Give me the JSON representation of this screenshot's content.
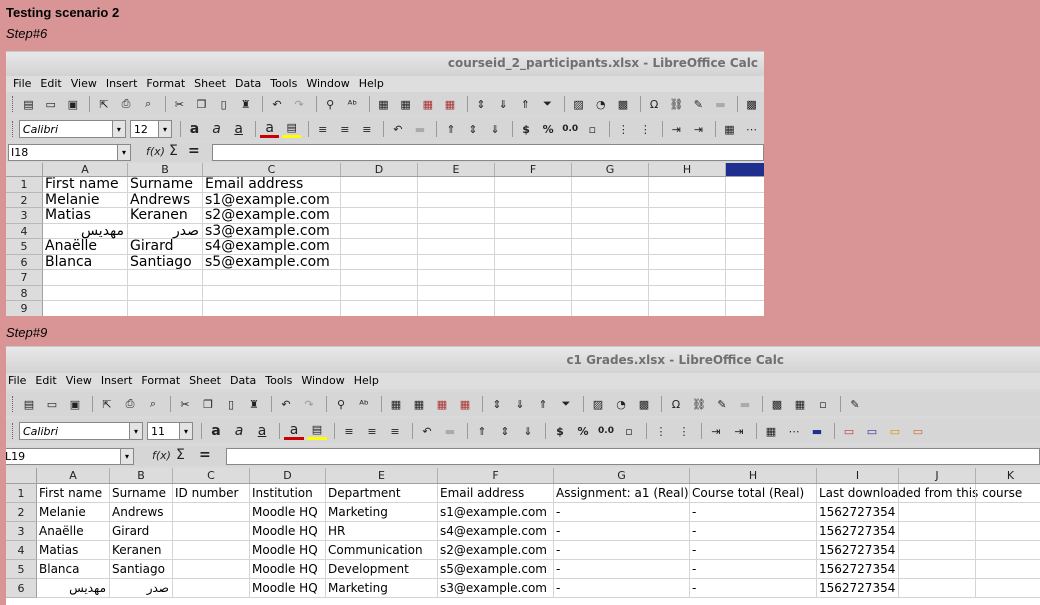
{
  "scenario_title": "Testing scenario 2",
  "steps": [
    "Step#6",
    "Step#9"
  ],
  "menu": [
    "File",
    "Edit",
    "View",
    "Insert",
    "Format",
    "Sheet",
    "Data",
    "Tools",
    "Window",
    "Help"
  ],
  "window1": {
    "title": "courseid_2_participants.xlsx - LibreOffice Calc",
    "font_name": "Calibri",
    "font_size": "12",
    "cell_ref": "I18",
    "fx_label": "f(x)",
    "sigma": "Σ",
    "equals": "=",
    "columns": [
      "A",
      "B",
      "C",
      "D",
      "E",
      "F",
      "G",
      "H"
    ],
    "rows": [
      "1",
      "2",
      "3",
      "4",
      "5",
      "6",
      "7",
      "8",
      "9"
    ],
    "cells": [
      [
        "First name",
        "Surname",
        "Email address"
      ],
      [
        "Melanie",
        "Andrews",
        "s1@example.com"
      ],
      [
        "Matias",
        "Keranen",
        "s2@example.com"
      ],
      [
        "مهدیس",
        "صدر",
        "s3@example.com"
      ],
      [
        "Anaëlle",
        "Girard",
        "s4@example.com"
      ],
      [
        "Blanca",
        "Santiago",
        "s5@example.com"
      ]
    ]
  },
  "window2": {
    "title": "c1 Grades.xlsx - LibreOffice Calc",
    "font_name": "Calibri",
    "font_size": "11",
    "cell_ref": "L19",
    "fx_label": "f(x)",
    "sigma": "Σ",
    "equals": "=",
    "columns": [
      "A",
      "B",
      "C",
      "D",
      "E",
      "F",
      "G",
      "H",
      "I",
      "J",
      "K"
    ],
    "rows": [
      "1",
      "2",
      "3",
      "4",
      "5",
      "6"
    ],
    "cells": [
      [
        "First name",
        "Surname",
        "ID number",
        "Institution",
        "Department",
        "Email address",
        "Assignment: a1 (Real)",
        "Course total (Real)",
        "Last downloaded from this course"
      ],
      [
        "Melanie",
        "Andrews",
        "",
        "Moodle HQ",
        "Marketing",
        "s1@example.com",
        "-",
        "-",
        "1562727354"
      ],
      [
        "Anaëlle",
        "Girard",
        "",
        "Moodle HQ",
        "HR",
        "s4@example.com",
        "-",
        "-",
        "1562727354"
      ],
      [
        "Matias",
        "Keranen",
        "",
        "Moodle HQ",
        "Communication",
        "s2@example.com",
        "-",
        "-",
        "1562727354"
      ],
      [
        "Blanca",
        "Santiago",
        "",
        "Moodle HQ",
        "Development",
        "s5@example.com",
        "-",
        "-",
        "1562727354"
      ],
      [
        "مهدیس",
        "صدر",
        "",
        "Moodle HQ",
        "Marketing",
        "s3@example.com",
        "-",
        "-",
        "1562727354"
      ]
    ]
  },
  "icons": [
    "new-icon",
    "open-icon",
    "save-icon",
    "pdf-icon",
    "print-icon",
    "preview-icon",
    "cut-icon",
    "copy-icon",
    "paste-icon",
    "clone-icon",
    "undo-icon",
    "redo-icon",
    "find-icon",
    "spellcheck-icon",
    "row-icon",
    "column-icon",
    "sort-icon",
    "filter-icon",
    "image-icon",
    "chart-icon",
    "pivot-icon",
    "special-char-icon",
    "hyperlink-icon",
    "comment-icon",
    "header-footer-icon",
    "bold-icon",
    "italic-icon",
    "underline-icon",
    "font-color-icon",
    "highlight-icon",
    "align-icon",
    "currency-icon",
    "percent-icon",
    "number-icon",
    "date-icon",
    "decimal-icon",
    "indent-icon",
    "borders-icon",
    "border-style-icon",
    "border-color-icon",
    "condition-icon"
  ],
  "glyphs": {
    "new": "▤",
    "open": "▭",
    "save": "▣",
    "exp": "⇱",
    "print": "⎙",
    "prev": "⌕",
    "cut": "✂",
    "copy": "❐",
    "paste": "▯",
    "clone": "♜",
    "undo": "↶",
    "redo": "↷",
    "find": "⚲",
    "spell": "ᴬᵇ",
    "rowins": "▦",
    "colins": "▦",
    "rowdel": "▦",
    "coldel": "▦",
    "hsplit": "⇕",
    "sortd": "⇓",
    "sorta": "⇑",
    "filt": "⏷",
    "img": "▨",
    "chart": "◔",
    "pivot": "▩",
    "spec": "Ω",
    "link": "⛓",
    "pen": "✎",
    "note": "▬",
    "bold": "a",
    "ital": "a",
    "und": "a",
    "fcol": "a",
    "hl": "▤",
    "al": "≡",
    "cur": "$",
    "pct": "%",
    "num": "0.0",
    "date": "▫",
    "dec": "⋮",
    "ind": "⇥",
    "bord": "▦",
    "bstyle": "⋯",
    "bcol": "▬",
    "cond1": "▭",
    "cond2": "▭",
    "cond3": "▭",
    "cond4": "▭",
    "drop": "▾"
  }
}
